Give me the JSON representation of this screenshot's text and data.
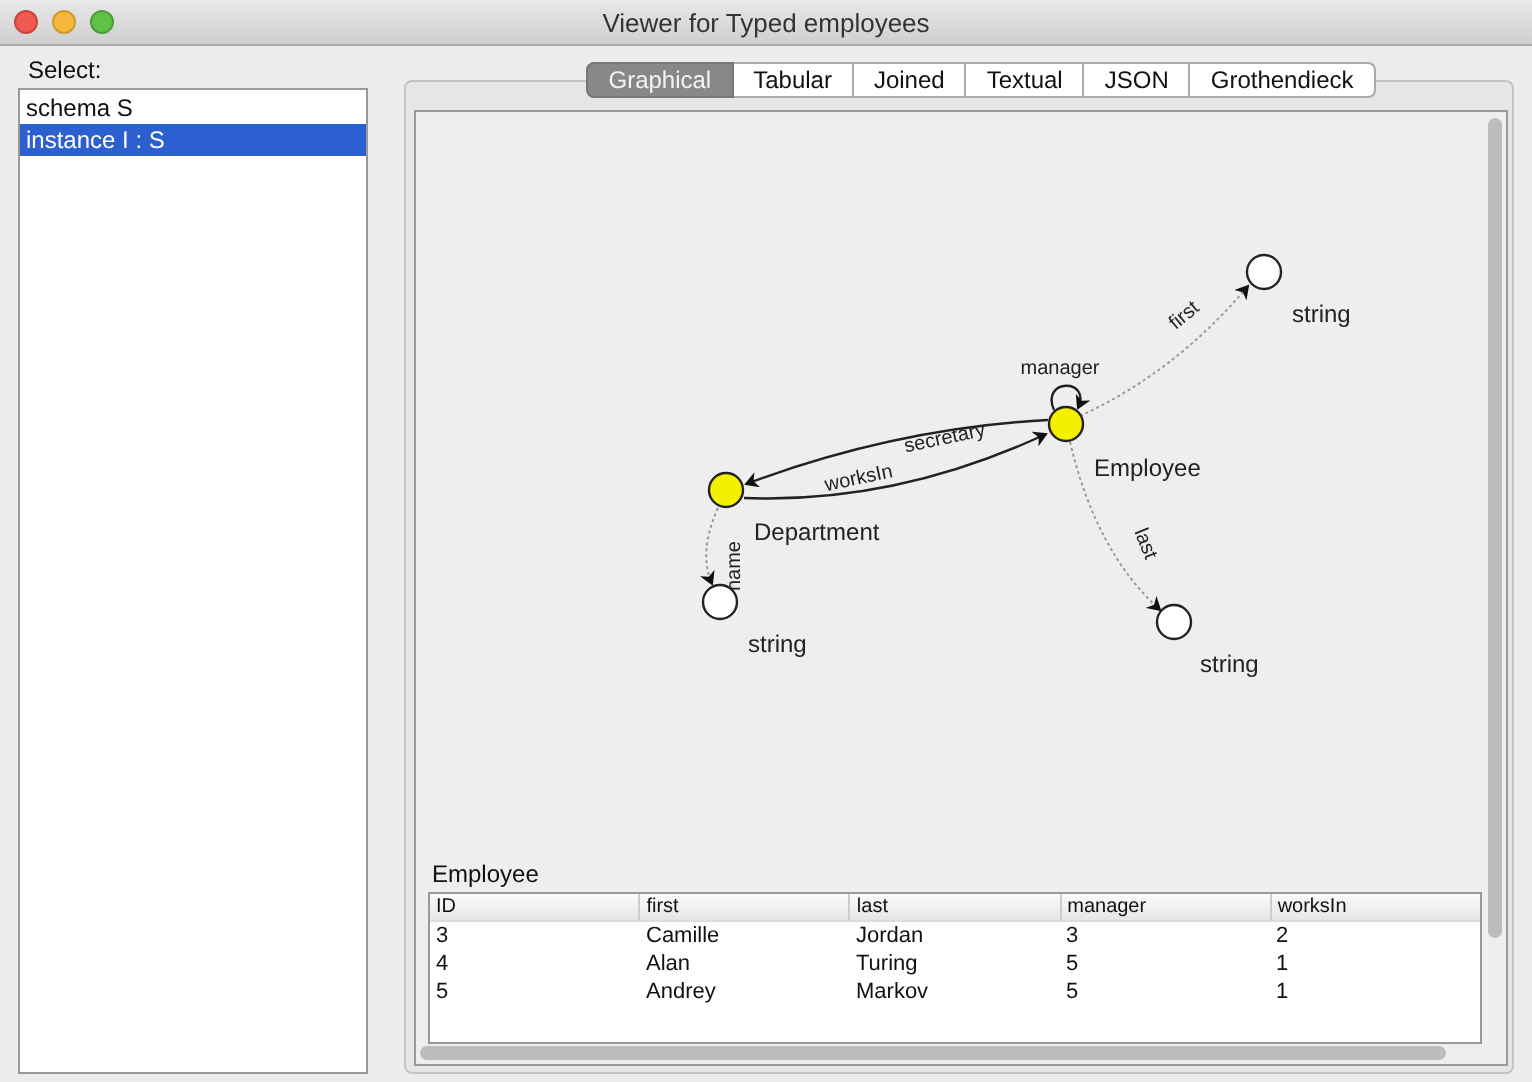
{
  "window": {
    "title": "Viewer for Typed employees"
  },
  "sidebar": {
    "label": "Select:",
    "items": [
      {
        "label": "schema S",
        "selected": false
      },
      {
        "label": "instance I : S",
        "selected": true
      }
    ]
  },
  "tabs": [
    {
      "label": "Graphical",
      "selected": true
    },
    {
      "label": "Tabular",
      "selected": false
    },
    {
      "label": "Joined",
      "selected": false
    },
    {
      "label": "Textual",
      "selected": false
    },
    {
      "label": "JSON",
      "selected": false
    },
    {
      "label": "Grothendieck",
      "selected": false
    }
  ],
  "graph": {
    "nodes": [
      {
        "label": "Department",
        "kind": "entity"
      },
      {
        "label": "Employee",
        "kind": "entity"
      },
      {
        "label": "string",
        "kind": "type"
      },
      {
        "label": "string",
        "kind": "type"
      },
      {
        "label": "string",
        "kind": "type"
      }
    ],
    "edges": [
      {
        "label": "first",
        "kind": "attribute"
      },
      {
        "label": "manager",
        "kind": "foreign"
      },
      {
        "label": "secretary",
        "kind": "foreign"
      },
      {
        "label": "worksIn",
        "kind": "foreign"
      },
      {
        "label": "name",
        "kind": "attribute"
      },
      {
        "label": "last",
        "kind": "attribute"
      }
    ]
  },
  "table": {
    "title": "Employee",
    "columns": [
      "ID",
      "first",
      "last",
      "manager",
      "worksIn"
    ],
    "rows": [
      [
        "3",
        "Camille",
        "Jordan",
        "3",
        "2"
      ],
      [
        "4",
        "Alan",
        "Turing",
        "5",
        "1"
      ],
      [
        "5",
        "Andrey",
        "Markov",
        "5",
        "1"
      ]
    ]
  }
}
